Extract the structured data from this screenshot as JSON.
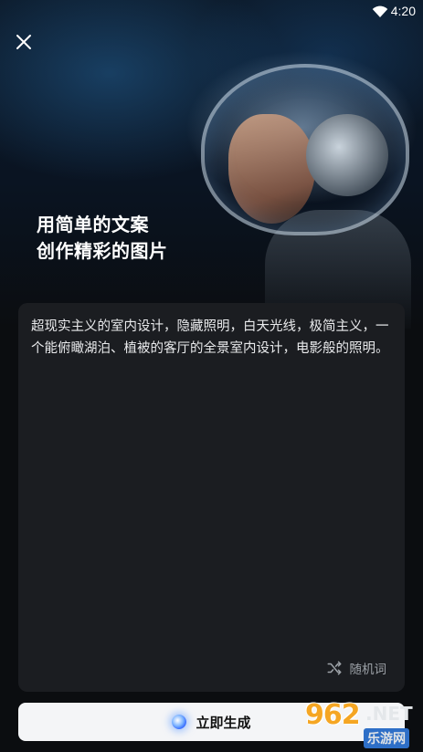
{
  "status_bar": {
    "time": "4:20",
    "wifi_icon": "wifi-icon"
  },
  "header": {
    "close_icon": "close-icon"
  },
  "headline": {
    "line1": "用简单的文案",
    "line2": "创作精彩的图片"
  },
  "prompt": {
    "text": "超现实主义的室内设计，隐藏照明，白天光线，极简主义，一个能俯瞰湖泊、植被的客厅的全景室内设计，电影般的照明。",
    "random_label": "随机词",
    "random_icon": "shuffle-icon"
  },
  "actions": {
    "generate_label": "立即生成",
    "generate_icon": "glow-orb-icon"
  },
  "watermark": {
    "number": "962",
    "suffix": ".NET",
    "site": "乐游网"
  },
  "colors": {
    "background": "#0b0d10",
    "card": "#1b1d21",
    "button": "#f4f5f7",
    "watermark_orange": "#f5a623",
    "watermark_blue": "#2e6fc7"
  }
}
